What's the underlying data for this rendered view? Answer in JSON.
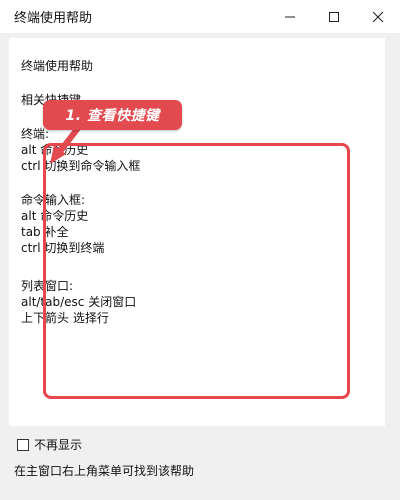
{
  "window": {
    "title": "终端使用帮助"
  },
  "help": {
    "heading": "终端使用帮助",
    "related_label": "相关快捷键",
    "terminal": {
      "label": "终端:",
      "line1": "alt 命令历史",
      "line2": "ctrl 切换到命令输入框"
    },
    "input_box": {
      "label": "命令输入框:",
      "line1": "alt 命令历史",
      "line2": "tab 补全",
      "line3": "ctrl 切换到终端"
    },
    "list_window": {
      "label": "列表窗口:",
      "line1": "alt/tab/esc 关闭窗口",
      "line2": "上下箭头 选择行"
    }
  },
  "annotation": {
    "callout_text": "1. 查看快捷键",
    "color": "#e24a4f"
  },
  "footer": {
    "checkbox_label": "不再显示",
    "checkbox_checked": false,
    "hint": "在主窗口右上角菜单可找到该帮助"
  }
}
